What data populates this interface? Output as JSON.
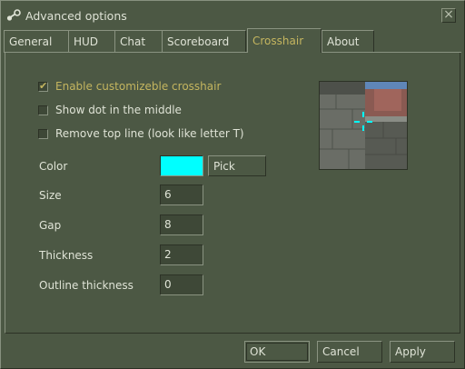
{
  "window": {
    "title": "Advanced options",
    "close_symbol": "×"
  },
  "tabs": [
    {
      "label": "General"
    },
    {
      "label": "HUD"
    },
    {
      "label": "Chat"
    },
    {
      "label": "Scoreboard"
    },
    {
      "label": "Crosshair",
      "active": true
    },
    {
      "label": "About"
    }
  ],
  "crosshair": {
    "options": [
      {
        "label": "Enable customizeble crosshair",
        "checked": true
      },
      {
        "label": "Show dot in the middle",
        "checked": false
      },
      {
        "label": "Remove top line (look like letter T)",
        "checked": false
      }
    ],
    "color": {
      "label": "Color",
      "value": "#00ffff",
      "pick_label": "Pick"
    },
    "size": {
      "label": "Size",
      "value": "6"
    },
    "gap": {
      "label": "Gap",
      "value": "8"
    },
    "thickness": {
      "label": "Thickness",
      "value": "2"
    },
    "outline_thickness": {
      "label": "Outline thickness",
      "value": "0"
    }
  },
  "buttons": {
    "ok": "OK",
    "cancel": "Cancel",
    "apply": "Apply"
  },
  "colors": {
    "accent": "#c4b55f",
    "background": "#4c5844",
    "crosshair": "#00ffff"
  }
}
